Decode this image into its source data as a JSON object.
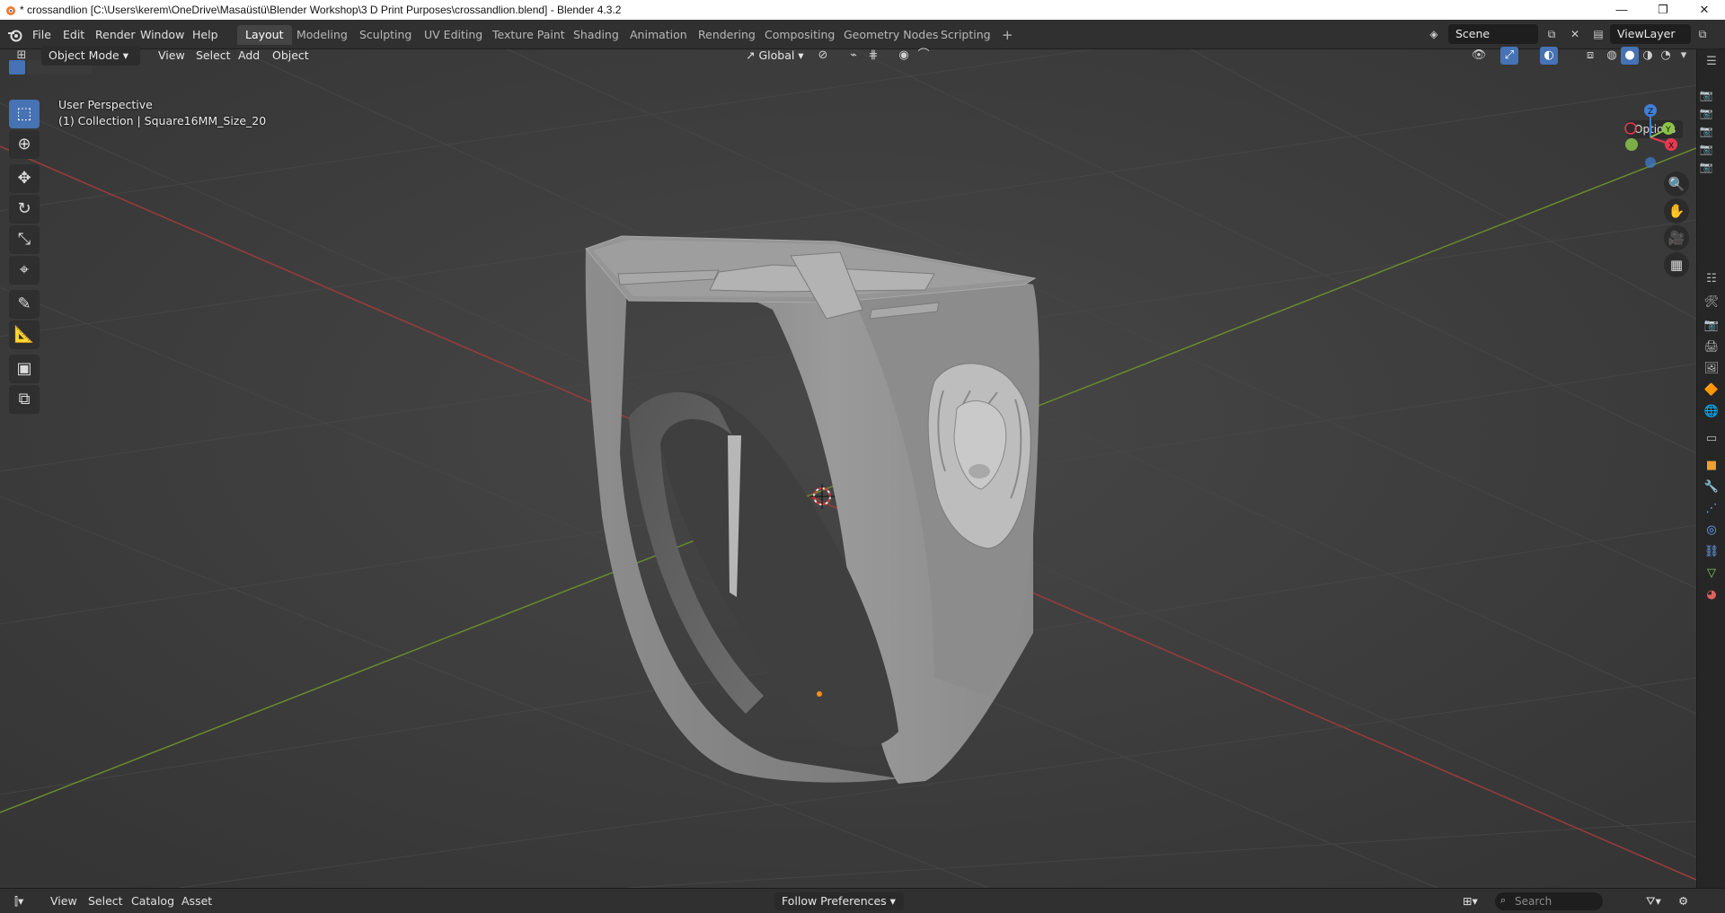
{
  "window": {
    "title": "* crossandlion [C:\\Users\\kerem\\OneDrive\\Masaüstü\\Blender Workshop\\3 D Print Purposes\\crossandlion.blend] - Blender 4.3.2",
    "minimize": "—",
    "restore": "❐",
    "close": "✕"
  },
  "menu": {
    "file": "File",
    "edit": "Edit",
    "render": "Render",
    "window": "Window",
    "help": "Help"
  },
  "workspaces": [
    "Layout",
    "Modeling",
    "Sculpting",
    "UV Editing",
    "Texture Paint",
    "Shading",
    "Animation",
    "Rendering",
    "Compositing",
    "Geometry Nodes",
    "Scripting"
  ],
  "active_workspace": "Layout",
  "add_workspace": "+",
  "scene": {
    "name": "Scene"
  },
  "view_layer": {
    "name": "ViewLayer"
  },
  "viewport_header": {
    "mode": "Object Mode",
    "view": "View",
    "select": "Select",
    "add": "Add",
    "object": "Object",
    "transform_orientation": "Global",
    "options": "Options"
  },
  "overlay": {
    "perspective": "User Perspective",
    "collection_info": "(1) Collection | Square16MM_Size_20"
  },
  "gizmo_axes": {
    "x": "X",
    "y": "Y",
    "z": "Z",
    "x_color": "#e8384f",
    "y_color": "#8bc34a",
    "z_color": "#3f7fd6"
  },
  "bottom": {
    "view": "View",
    "select": "Select",
    "catalog": "Catalog",
    "asset": "Asset",
    "import_method": "Follow Preferences",
    "search_placeholder": "Search"
  },
  "colors": {
    "accent": "#4772b3",
    "x_axis_line": "#9c3b3b",
    "y_axis_line": "#6b8a2e"
  }
}
